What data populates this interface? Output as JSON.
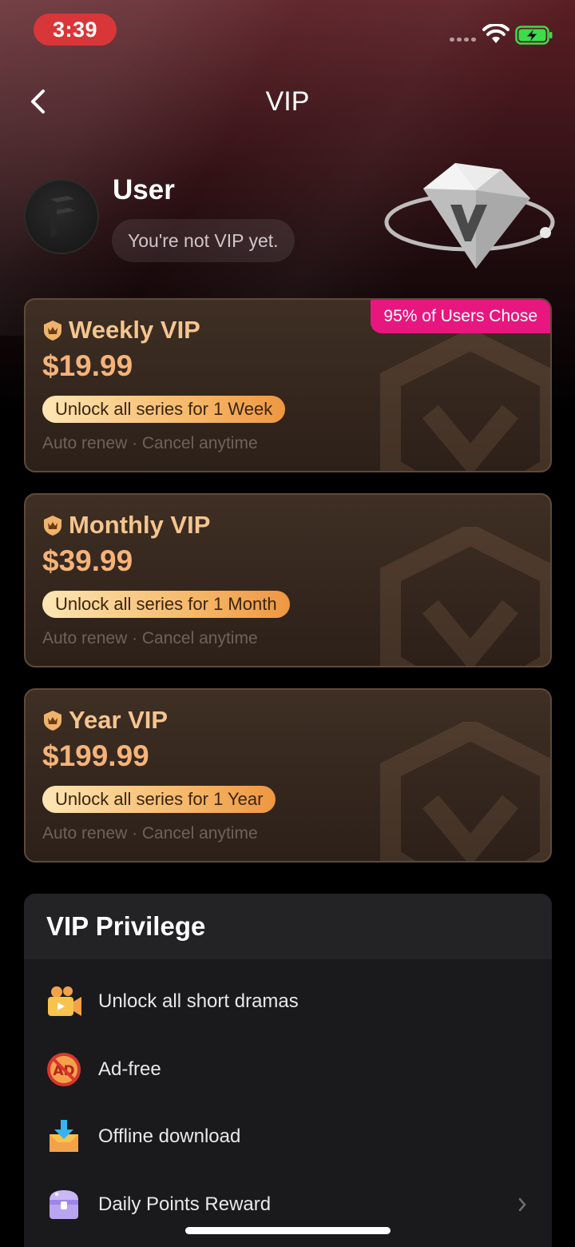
{
  "status_bar": {
    "time": "3:39"
  },
  "header": {
    "title": "VIP",
    "back_icon": "chevron-left-icon"
  },
  "profile": {
    "username": "User",
    "status": "You're not VIP yet."
  },
  "plans": [
    {
      "name": "Weekly VIP",
      "price": "$19.99",
      "benefit": "Unlock all series for 1 Week",
      "renew": "Auto renew · Cancel anytime",
      "badge": "95% of Users Chose"
    },
    {
      "name": "Monthly VIP",
      "price": "$39.99",
      "benefit": "Unlock all series for 1 Month",
      "renew": "Auto renew · Cancel anytime"
    },
    {
      "name": "Year VIP",
      "price": "$199.99",
      "benefit": "Unlock all series for 1 Year",
      "renew": "Auto renew · Cancel anytime"
    }
  ],
  "privilege": {
    "title": "VIP Privilege",
    "items": [
      {
        "label": "Unlock all short dramas",
        "icon": "video-camera-icon"
      },
      {
        "label": "Ad-free",
        "icon": "no-ads-icon"
      },
      {
        "label": "Offline download",
        "icon": "download-box-icon"
      },
      {
        "label": "Daily Points Reward",
        "icon": "treasure-chest-icon"
      }
    ]
  },
  "colors": {
    "accent_gold": "#f5b37a",
    "badge_pink": "#e7177f",
    "time_pill_red": "#d9363a"
  }
}
